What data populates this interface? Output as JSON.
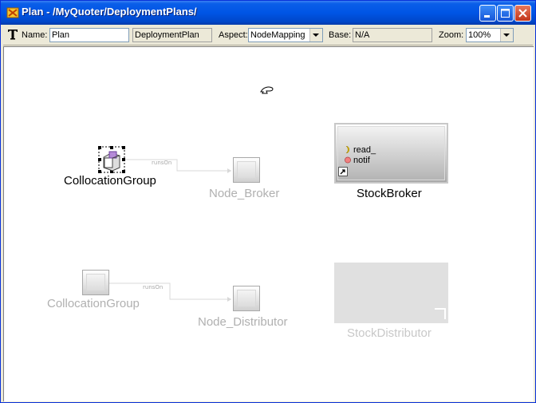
{
  "window": {
    "title": "Plan - /MyQuoter/DeploymentPlans/",
    "colors": {
      "titlebar": "#0055e5",
      "close_button": "#c2351a"
    }
  },
  "toolbar": {
    "name_label": "Name:",
    "name_value": "Plan",
    "kind_value": "DeploymentPlan",
    "aspect_label": "Aspect:",
    "aspect_value": "NodeMapping",
    "base_label": "Base:",
    "base_value": "N/A",
    "zoom_label": "Zoom:",
    "zoom_value": "100%"
  },
  "canvas": {
    "colocation_group_active": {
      "label": "CollocationGroup"
    },
    "node_broker": {
      "label": "Node_Broker"
    },
    "connection_runs_on_1": {
      "label": "runsOn"
    },
    "stock_broker": {
      "label": "StockBroker",
      "ports": [
        {
          "label": "read_",
          "icon": "facet-port-icon",
          "color": "#e8c800"
        },
        {
          "label": "notif",
          "icon": "event-port-icon",
          "color": "#e86060"
        }
      ]
    },
    "colocation_group_inactive": {
      "label": "CollocationGroup"
    },
    "node_distributor": {
      "label": "Node_Distributor"
    },
    "connection_runs_on_2": {
      "label": "runsOn"
    },
    "stock_distributor": {
      "label": "StockDistributor"
    }
  }
}
